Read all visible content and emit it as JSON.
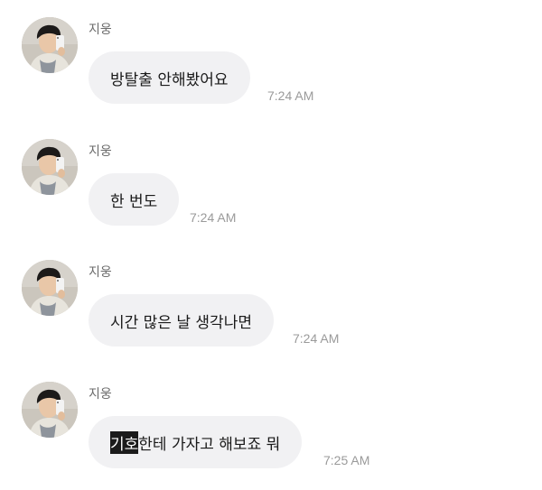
{
  "messages": [
    {
      "sender": "지웅",
      "text": "방탈출 안해봤어요",
      "time": "7:24 AM"
    },
    {
      "sender": "지웅",
      "text": "한 번도",
      "time": "7:24 AM"
    },
    {
      "sender": "지웅",
      "text": "시간 많은 날 생각나면",
      "time": "7:24 AM"
    },
    {
      "sender": "지웅",
      "text_highlight": "기호",
      "text_rest": "한테 가자고 해보죠 뭐",
      "time": "7:25 AM"
    }
  ],
  "colors": {
    "bubble": "#f1f1f3",
    "highlight": "#1b1b1b"
  }
}
